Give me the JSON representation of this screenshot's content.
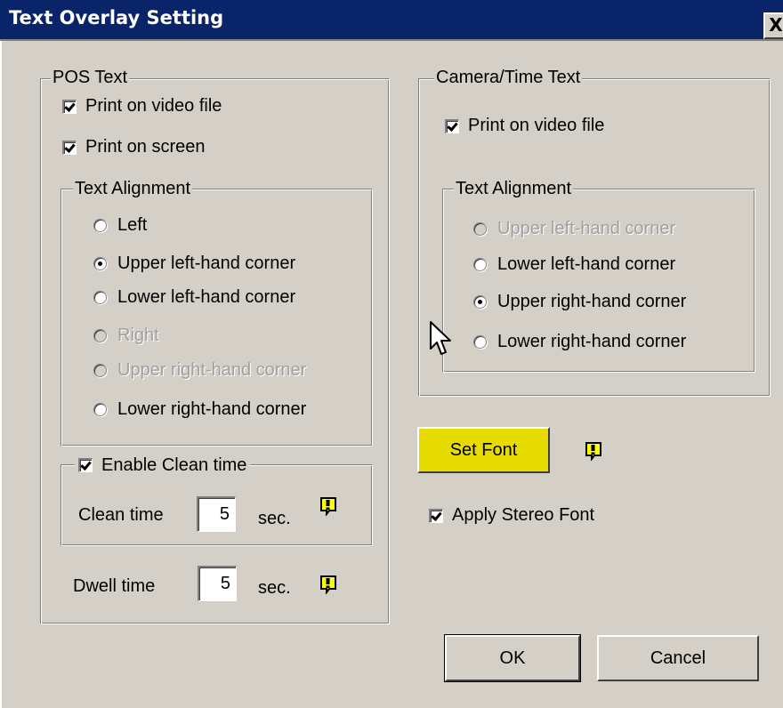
{
  "window": {
    "title": "Text Overlay Setting",
    "close_label": "X"
  },
  "pos_text": {
    "legend": "POS Text",
    "print_video_file": {
      "label": "Print on video file",
      "checked": true
    },
    "print_screen": {
      "label": "Print on screen",
      "checked": true
    },
    "alignment": {
      "legend": "Text Alignment",
      "options": [
        {
          "label": "Left",
          "selected": false,
          "enabled": true
        },
        {
          "label": "Upper left-hand corner",
          "selected": true,
          "enabled": true
        },
        {
          "label": "Lower left-hand corner",
          "selected": false,
          "enabled": true
        },
        {
          "label": "Right",
          "selected": false,
          "enabled": false
        },
        {
          "label": "Upper right-hand corner",
          "selected": false,
          "enabled": false
        },
        {
          "label": "Lower right-hand corner",
          "selected": false,
          "enabled": true
        }
      ]
    },
    "clean_time": {
      "enable_label": "Enable Clean time",
      "enabled": true,
      "label": "Clean time",
      "value": "5",
      "unit": "sec."
    },
    "dwell_time": {
      "label": "Dwell time",
      "value": "5",
      "unit": "sec."
    }
  },
  "camera_text": {
    "legend": "Camera/Time Text",
    "print_video_file": {
      "label": "Print on video file",
      "checked": true
    },
    "alignment": {
      "legend": "Text Alignment",
      "options": [
        {
          "label": "Upper left-hand corner",
          "selected": false,
          "enabled": false
        },
        {
          "label": "Lower left-hand corner",
          "selected": false,
          "enabled": true
        },
        {
          "label": "Upper right-hand corner",
          "selected": true,
          "enabled": true
        },
        {
          "label": "Lower right-hand corner",
          "selected": false,
          "enabled": true
        }
      ]
    }
  },
  "font": {
    "set_font_label": "Set Font",
    "set_font_color": "#e6dc00",
    "apply_stereo_label": "Apply Stereo Font",
    "apply_stereo_checked": true
  },
  "buttons": {
    "ok_label": "OK",
    "cancel_label": "Cancel"
  },
  "colors": {
    "titlebar": "#0a246a",
    "dialog_bg": "#d4d0c8",
    "info_icon": "#ffff00"
  },
  "icons": [
    "info-icon",
    "mouse-pointer-icon",
    "close-icon"
  ]
}
